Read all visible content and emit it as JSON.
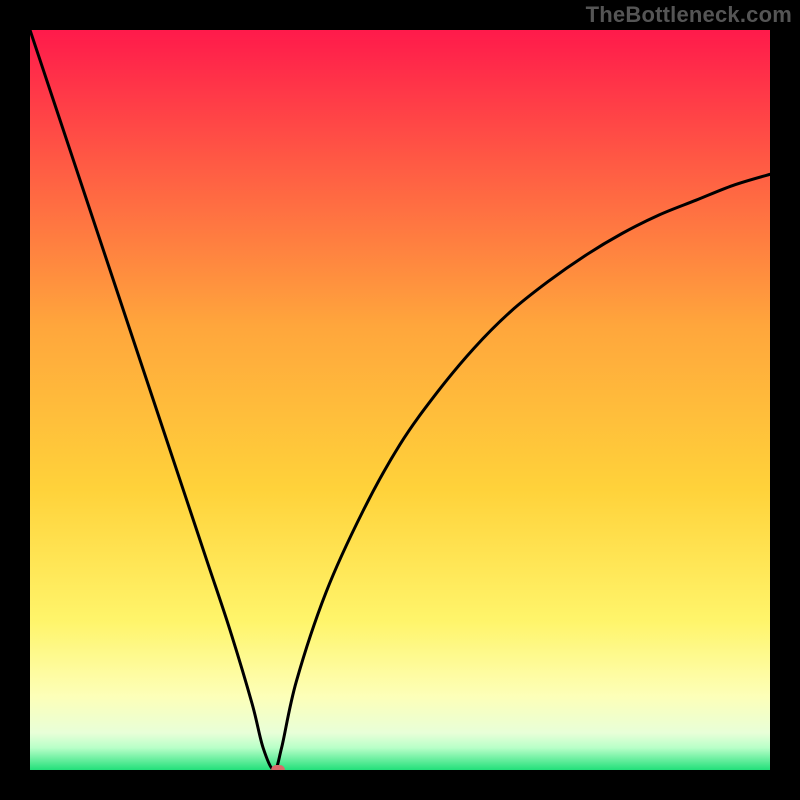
{
  "watermark": "TheBottleneck.com",
  "colors": {
    "gradient_top": "#ff1a4b",
    "gradient_mid1": "#ff7a3a",
    "gradient_mid2": "#ffd23a",
    "gradient_mid3": "#fff56b",
    "gradient_low": "#f6ffd2",
    "gradient_bottom": "#22e07a",
    "curve": "#000000",
    "marker": "#d86a6a",
    "frame": "#000000"
  },
  "chart_data": {
    "type": "line",
    "title": "",
    "xlabel": "",
    "ylabel": "",
    "xlim": [
      0,
      100
    ],
    "ylim": [
      0,
      100
    ],
    "min_point": {
      "x": 33,
      "y": 0
    },
    "series": [
      {
        "name": "bottleneck_curve",
        "x": [
          0,
          3,
          6,
          9,
          12,
          15,
          18,
          21,
          24,
          27,
          30,
          31.5,
          33,
          34,
          36,
          40,
          45,
          50,
          55,
          60,
          65,
          70,
          75,
          80,
          85,
          90,
          95,
          100
        ],
        "y": [
          100,
          91,
          82,
          73,
          64,
          55,
          46,
          37,
          28,
          19,
          9,
          3,
          0,
          3,
          12,
          24,
          35,
          44,
          51,
          57,
          62,
          66,
          69.5,
          72.5,
          75,
          77,
          79,
          80.5
        ]
      }
    ],
    "markers": [
      {
        "x": 33.5,
        "y": 0
      }
    ]
  }
}
